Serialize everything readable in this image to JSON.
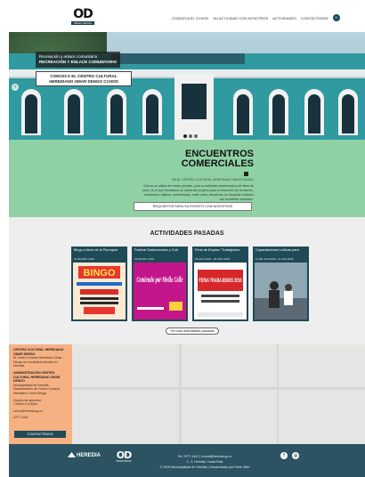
{
  "header": {
    "logo_mark": "OD",
    "logo_subtitle": "OMAR DENGO",
    "nav": [
      "CONOZCA EL CCHOD",
      "SU ACTIVIDAD CON NOSOTROS",
      "ACTIVIDADES",
      "CONTÁCTENOS"
    ],
    "badge": "0"
  },
  "hero": {
    "caption_line1": "Recreación y enlace comunitario",
    "caption_line2": "RECREACIÓN Y ENLACE COMUNITARIO",
    "cta_label": "CONOZCA EL CENTRO CULTURAL HEREDIANO OMAR DENGO CCHOD",
    "prev_arrow": "‹",
    "slides_total": 3,
    "active_slide": 1
  },
  "encuentros": {
    "title_line1": "ENCUENTROS",
    "title_line2": "COMERCIALES",
    "subtitle": "EN EL CENTRO CULTURAL HEREDIANO OMAR DENGO",
    "description": "Somos un aliado del sector privado, para su actividad empresarial y sin fines de lucro, en el que brindamos un ambiente propicio para el desarrollo de reuniones, seminarios, talleres, conferencias, entre otros; ofreciendo un inmueble histórico con excelente ubicación.",
    "button_label": "REQUISITOS PARA SU EVENTO CON NOSOTROS"
  },
  "activities": {
    "title": "ACTIVIDADES PASADAS",
    "cards": [
      {
        "title": "Bingo a favor de la Parroquia",
        "date": "13 DE MAY 2018"
      },
      {
        "title": "Festival Gastronómico y Cult.",
        "date": "22 DE DIC 2018"
      },
      {
        "title": "Feria de Empleo \"Trabajemos",
        "date": "25 AGO 2018 - 26 AGO 2018"
      },
      {
        "title": "Capacitaciones Lúdicas para",
        "date": "11 DE JUN 2018 - 12 JUN 2018"
      }
    ],
    "poster1_title": "BINGO",
    "poster2_title": "Comiendo por Media Calle",
    "poster3_title": "FERIA TRABAJEMOS 2018",
    "more_label": "Ver más actividades pasadas"
  },
  "info": {
    "title": "CENTRO CULTURAL HEREDIANO OMAR DENGO",
    "line1": "El Centro Cultural Herediano Omar Dengo se encuentra ubicado en Heredia.",
    "admin_title": "ADMINISTRACIÓN CENTRO CULTURAL HEREDIANO OMAR DENGO",
    "admin_text": "Municipalidad de Heredia, Departamento de Centro Cultural Herediano Omar Dengo.",
    "hours_label": "Horario de atención:",
    "hours": "7:00am a 4:00pm",
    "email": "cchod@heredia.go.cr",
    "phone": "2277-1441",
    "button_label": "CONTÁCTENOS"
  },
  "footer": {
    "logo1_text": "HEREDIA",
    "logo2_mark": "OD",
    "logo2_sub": "OMAR DENGO",
    "phone_email": "Tel: 2277-1441 | cchod@heredia.go.cr",
    "address": "C. 3, Heredia, Costa Rica",
    "copyright": "© 2020 Municipalidad de Heredia | Desarrollado por Fénix Web",
    "social": [
      "f",
      "◎"
    ]
  },
  "colors": {
    "teal_dark": "#1f4a57",
    "mint": "#8fd1a4",
    "peach": "#f6b183",
    "footer": "#2b5361",
    "light_gray": "#eeeeee"
  }
}
